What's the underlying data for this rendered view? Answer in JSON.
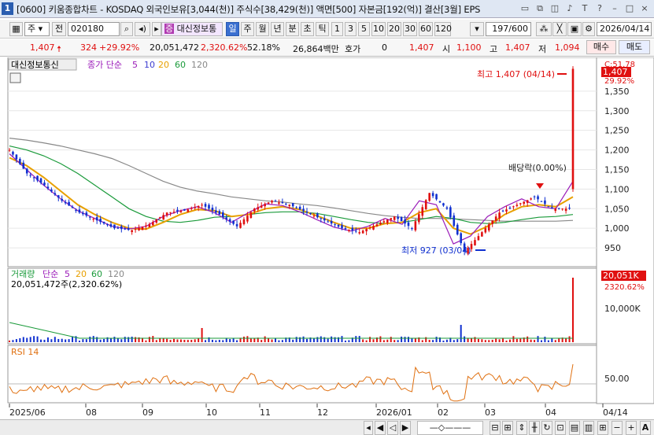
{
  "titlebar": {
    "window_num": "1",
    "title": "[0600] 키움종합차트 - KOSDAQ 외국인보유[3,044(천)] 주식수[38,429(천)] 액면[500] 자본금[192(억)] 결산[3월] EPS"
  },
  "toolbar": {
    "period_select": "주",
    "all_button": "전",
    "code_input": "020180",
    "stock_name": "대신정보통",
    "interval_tabs": [
      "일",
      "주",
      "월",
      "년",
      "분",
      "초",
      "틱"
    ],
    "interval_selected": "일",
    "count_tabs": [
      "1",
      "3",
      "5",
      "10",
      "20",
      "30",
      "60",
      "120"
    ],
    "page_count": "197/600",
    "date_input": "2026/04/14"
  },
  "quote": {
    "price": "1,407",
    "change": "324",
    "change_pct": "+29.92%",
    "volume": "20,051,472",
    "volume_ratio": "2,320.62%",
    "turnover": "52.18%",
    "amount": "26,864백만",
    "hoga_label": "호가",
    "hoga_value": "0",
    "hoga_price": "1,407",
    "open_label": "시",
    "open": "1,100",
    "high_label": "고",
    "high": "1,407",
    "low_label": "저",
    "low": "1,094",
    "buy_button": "매수",
    "sell_button": "매도"
  },
  "price_panel": {
    "stock_label": "대신정보통신",
    "ma_label": "종가 단순",
    "ma_periods": [
      "5",
      "10",
      "20",
      "60",
      "120"
    ],
    "ma_colors": [
      "#9a1ab8",
      "#3b3bd0",
      "#e8a000",
      "#1a9a3a",
      "#888888"
    ],
    "high_annotation": "최고 1,407 (04/14)",
    "low_annotation": "최저 927 (03/04)",
    "dividend_annotation": "배당락(0.00%)",
    "last_price_tag": "1,407",
    "last_pct_tag": "29.92%",
    "top_tag": "C:51.78",
    "y_ticks": [
      "1,350",
      "1,300",
      "1,250",
      "1,200",
      "1,150",
      "1,100",
      "1,050",
      "1,000",
      "950"
    ]
  },
  "volume_panel": {
    "label": "거래량",
    "ma_label": "단순",
    "ma_periods": [
      "5",
      "20",
      "60",
      "120"
    ],
    "value_line": "20,051,472주(2,320.62%)",
    "last_tag": "20,051K",
    "last_pct": "2320.62%",
    "y_tick": "10,000K"
  },
  "rsi_panel": {
    "label": "RSI 14",
    "y_tick": "50.00"
  },
  "x_axis": [
    "2025/06",
    "08",
    "09",
    "10",
    "11",
    "12",
    "2026/01",
    "02",
    "03",
    "04",
    "04/14"
  ],
  "colors": {
    "up": "#e01010",
    "down": "#1030d0",
    "rsi": "#e07010",
    "accent": "#2a5db0"
  },
  "chart_data": {
    "type": "candlestick",
    "x": [
      "2025/06",
      "08",
      "09",
      "10",
      "11",
      "12",
      "2026/01",
      "02",
      "03",
      "04",
      "04/14"
    ],
    "close_series": [
      1200,
      1140,
      1110,
      1070,
      1040,
      1020,
      1000,
      995,
      1010,
      1040,
      1045,
      1060,
      1035,
      1005,
      1050,
      1070,
      1060,
      1040,
      1020,
      1000,
      990,
      1010,
      1030,
      1000,
      1090,
      1050,
      940,
      990,
      1040,
      1060,
      1080,
      1050,
      1050,
      1407
    ],
    "ma5": [
      1190,
      1150,
      1110,
      1075,
      1045,
      1025,
      1005,
      998,
      1005,
      1030,
      1045,
      1055,
      1040,
      1015,
      1040,
      1062,
      1058,
      1042,
      1022,
      1003,
      993,
      1005,
      1025,
      1010,
      1070,
      1060,
      960,
      980,
      1030,
      1055,
      1075,
      1055,
      1050,
      1120
    ],
    "ma20": [
      1180,
      1160,
      1130,
      1095,
      1060,
      1035,
      1015,
      1000,
      998,
      1015,
      1035,
      1048,
      1045,
      1030,
      1035,
      1050,
      1055,
      1048,
      1032,
      1015,
      1000,
      1000,
      1012,
      1015,
      1040,
      1050,
      1000,
      985,
      1005,
      1035,
      1055,
      1060,
      1055,
      1080
    ],
    "ma60": [
      1210,
      1200,
      1185,
      1165,
      1140,
      1110,
      1080,
      1050,
      1030,
      1018,
      1015,
      1020,
      1028,
      1030,
      1035,
      1040,
      1042,
      1042,
      1038,
      1030,
      1022,
      1015,
      1012,
      1015,
      1022,
      1030,
      1025,
      1015,
      1012,
      1015,
      1022,
      1028,
      1030,
      1035
    ],
    "ma120": [
      1230,
      1225,
      1218,
      1210,
      1200,
      1190,
      1178,
      1160,
      1140,
      1120,
      1105,
      1095,
      1088,
      1080,
      1075,
      1070,
      1067,
      1062,
      1058,
      1052,
      1045,
      1038,
      1032,
      1028,
      1025,
      1025,
      1024,
      1022,
      1020,
      1018,
      1018,
      1018,
      1018,
      1020
    ],
    "ylim": [
      910,
      1420
    ],
    "high": 1407,
    "low": 927,
    "volume_last": 20051472,
    "rsi_level": 50
  }
}
